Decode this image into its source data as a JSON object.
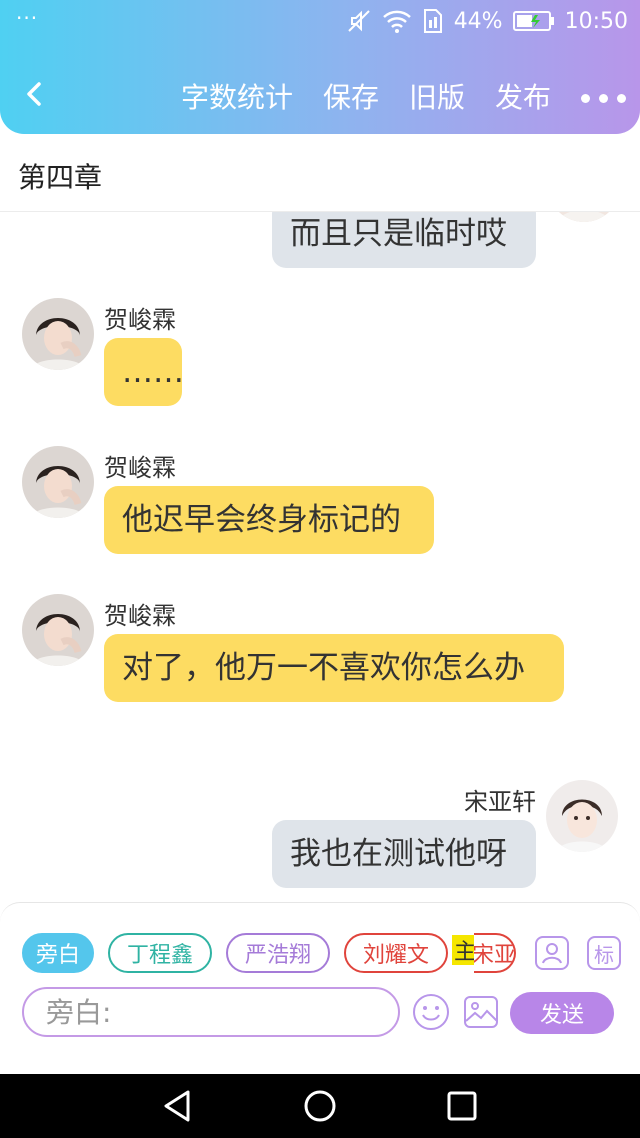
{
  "status_bar": {
    "battery": "44%",
    "time": "10:50",
    "dots": "···"
  },
  "nav": {
    "word_count_label": "字数统计",
    "save_label": "保存",
    "old_version_label": "旧版",
    "publish_label": "发布"
  },
  "chapter": {
    "title": "第四章"
  },
  "messages": [
    {
      "sender": "",
      "text": "而且只是临时哎",
      "side": "right"
    },
    {
      "sender": "贺峻霖",
      "text": "……",
      "side": "left"
    },
    {
      "sender": "贺峻霖",
      "text": "他迟早会终身标记的",
      "side": "left"
    },
    {
      "sender": "贺峻霖",
      "text": "对了，他万一不喜欢你怎么办",
      "side": "left"
    },
    {
      "sender": "宋亚轩",
      "text": "我也在测试他呀",
      "side": "right"
    }
  ],
  "characters": [
    {
      "label": "旁白",
      "color": "#54c6ec",
      "active": true
    },
    {
      "label": "丁程鑫",
      "color": "#2fb3a3",
      "active": false
    },
    {
      "label": "严浩翔",
      "color": "#a57bd8",
      "active": false
    },
    {
      "label": "刘耀文",
      "color": "#e0443c",
      "active": false
    },
    {
      "label": "主",
      "color": "#f5e600",
      "active": false
    },
    {
      "label": "宋亚",
      "color": "#e0443c",
      "active": false
    }
  ],
  "tools": {
    "mark_label": "标"
  },
  "input": {
    "placeholder": "旁白:",
    "send_label": "发送"
  },
  "colors": {
    "header_start": "#4fd0f2",
    "header_end": "#b896ea",
    "bubble_left": "#fddc62",
    "bubble_right": "#dfe4ea",
    "send": "#b886e8"
  }
}
